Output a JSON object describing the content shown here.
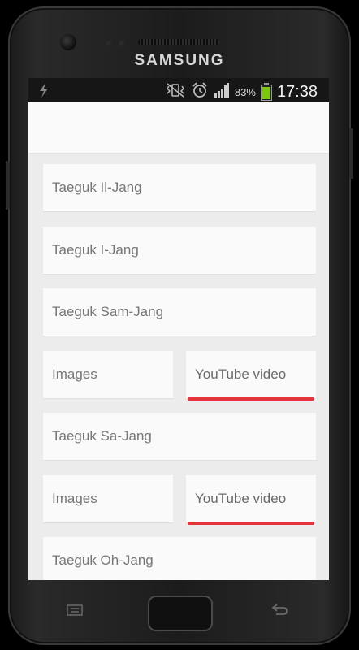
{
  "device": {
    "brand": "SAMSUNG"
  },
  "status_bar": {
    "battery_percent": "83%",
    "battery_level": 0.83,
    "time": "17:38",
    "battery_color": "#7ac70c",
    "icons": [
      "usb-debug-icon",
      "vibrate-icon",
      "alarm-icon",
      "signal-icon",
      "battery-icon"
    ]
  },
  "list": {
    "items": [
      {
        "label": "Taeguk Il-Jang"
      },
      {
        "label": "Taeguk I-Jang"
      },
      {
        "label": "Taeguk Sam-Jang"
      },
      {
        "images_label": "Images",
        "video_label": "YouTube video"
      },
      {
        "label": "Taeguk Sa-Jang"
      },
      {
        "images_label": "Images",
        "video_label": "YouTube video"
      },
      {
        "label": "Taeguk Oh-Jang"
      }
    ]
  },
  "colors": {
    "accent_red": "#e3343b",
    "card_bg": "#fafafa",
    "screen_bg": "#ececec"
  }
}
